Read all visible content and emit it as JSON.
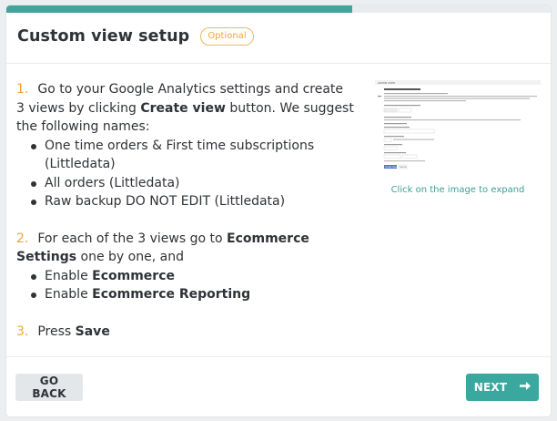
{
  "progress": {
    "fraction": 0.635
  },
  "header": {
    "title": "Custom view setup",
    "badge": "Optional"
  },
  "steps": [
    {
      "number": "1.",
      "text_a": "Go to your Google Analytics settings and create 3 views by clicking ",
      "bold_a": "Create view",
      "text_b": " button. We suggest the following names:",
      "items": [
        "One time orders & First time subscriptions (Littledata)",
        "All orders (Littledata)",
        "Raw backup DO NOT EDIT (Littledata)"
      ]
    },
    {
      "number": "2.",
      "text_a": "For each of the 3 views go to ",
      "bold_a": "Ecommerce Settings",
      "text_b": " one by one, and",
      "items": [
        {
          "prefix": "Enable ",
          "bold": "Ecommerce"
        },
        {
          "prefix": "Enable ",
          "bold": "Ecommerce Reporting"
        }
      ]
    },
    {
      "number": "3.",
      "text_a": "Press ",
      "bold_a": "Save"
    }
  ],
  "preview": {
    "caption": "Click on the image to expand",
    "thumb_tabs": [
      "ADMIN",
      "USER"
    ],
    "thumb_button": "Create View",
    "thumb_cancel": "Cancel"
  },
  "footer": {
    "back_label": "GO BACK",
    "next_label": "NEXT",
    "next_icon": "arrow-right-icon"
  },
  "colors": {
    "accent": "#43a39a",
    "step_number": "#f0a53b",
    "badge": "#f0a53b"
  }
}
